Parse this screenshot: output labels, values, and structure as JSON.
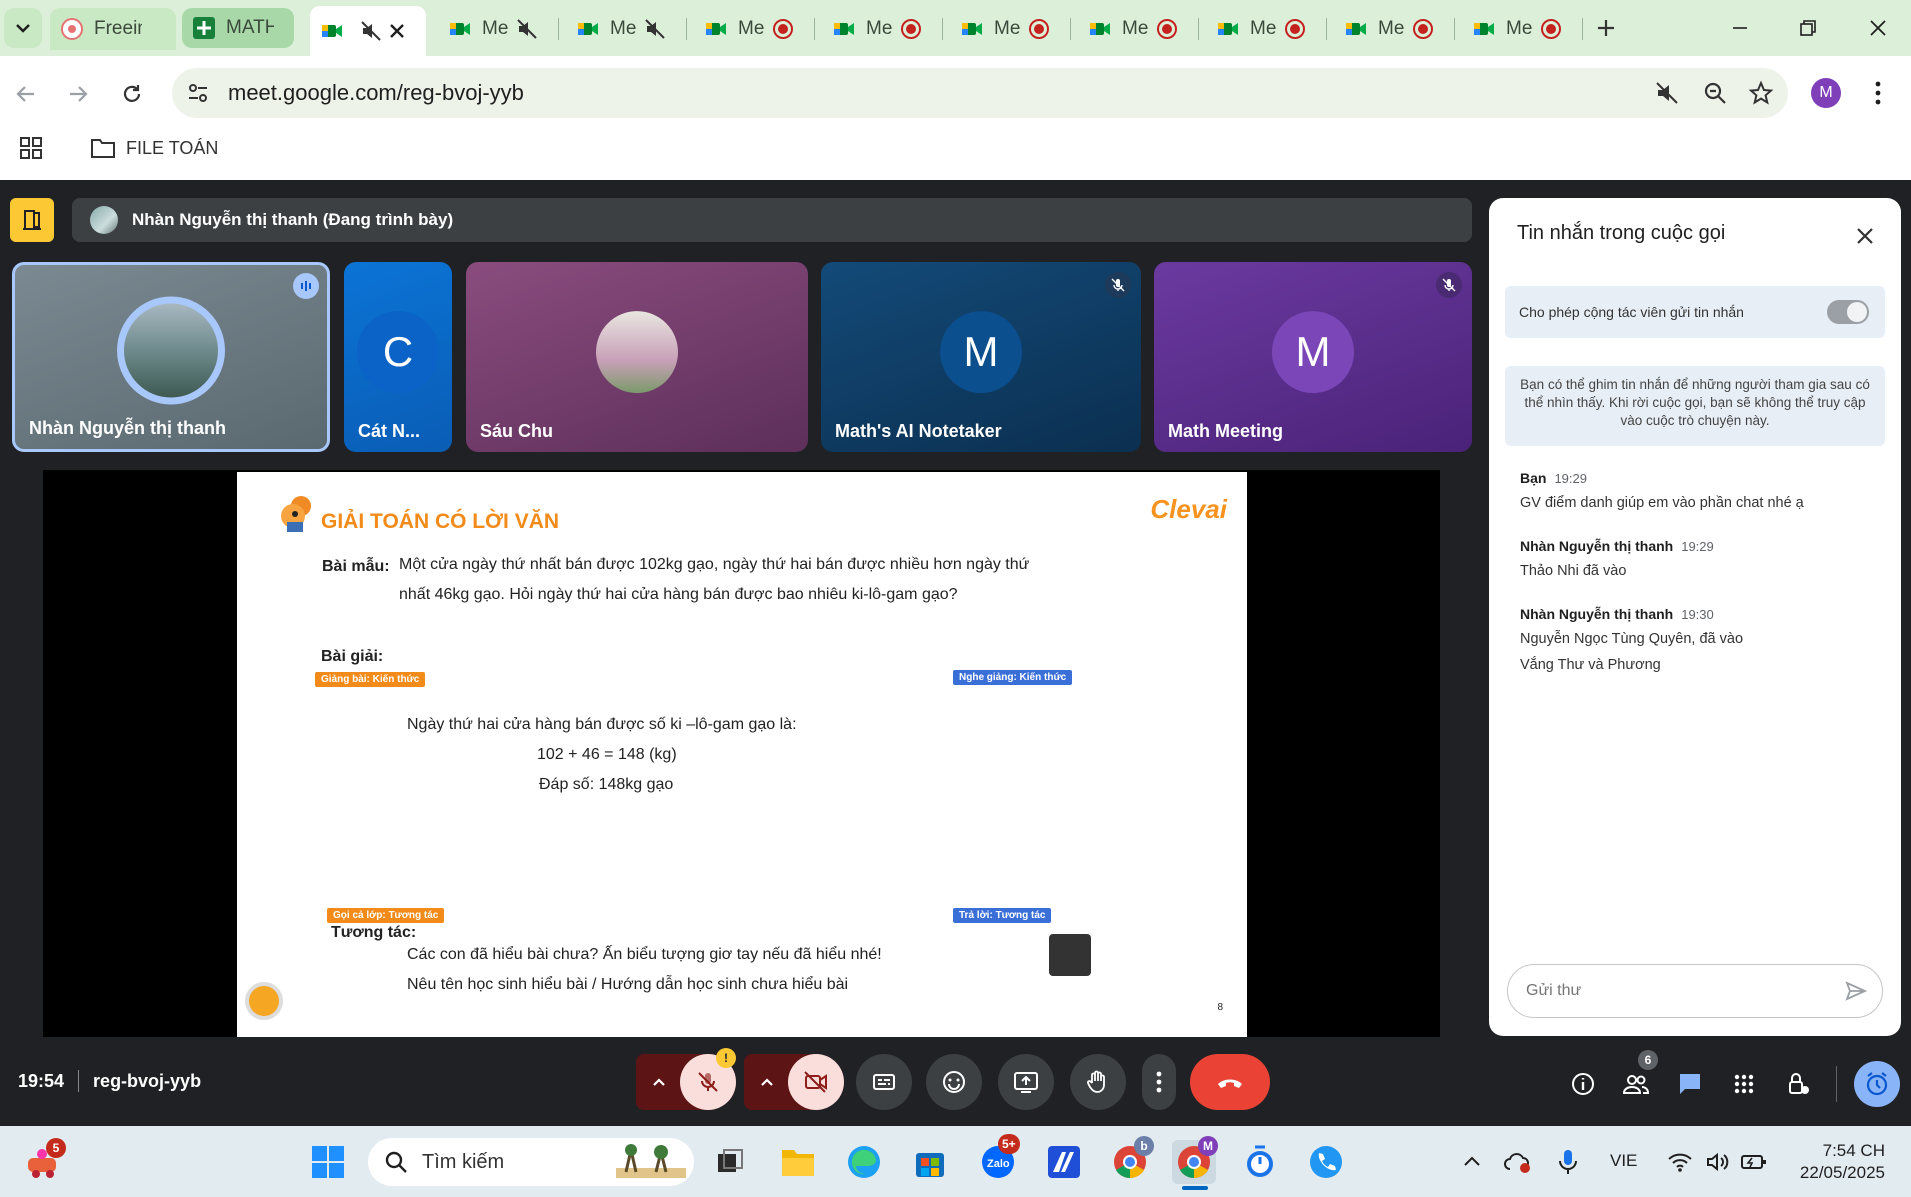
{
  "browser": {
    "tabs": [
      {
        "label": "Freeima",
        "kind": "freeimage"
      },
      {
        "label": "MATH_",
        "kind": "sheets"
      },
      {
        "label": "",
        "kind": "meet-active"
      },
      {
        "label": "Me",
        "kind": "meet-muted"
      },
      {
        "label": "Me",
        "kind": "meet-muted"
      },
      {
        "label": "Me",
        "kind": "meet-rec"
      },
      {
        "label": "Me",
        "kind": "meet-rec"
      },
      {
        "label": "Me",
        "kind": "meet-rec"
      },
      {
        "label": "Me",
        "kind": "meet-rec"
      },
      {
        "label": "Me",
        "kind": "meet-rec"
      },
      {
        "label": "Me",
        "kind": "meet-rec"
      },
      {
        "label": "Me",
        "kind": "meet-rec"
      }
    ],
    "url": "meet.google.com/reg-bvoj-yyb",
    "profile_initial": "M",
    "bookmark_folder": "FILE TOÁN"
  },
  "meet": {
    "presenting_text": "Nhàn Nguyễn thị thanh (Đang trình bày)",
    "tiles": [
      {
        "name": "Nhàn Nguyễn thị thanh",
        "initial": "",
        "bg": "#6f7d86"
      },
      {
        "name": "Cát N...",
        "initial": "C",
        "bg": "#1a73e8"
      },
      {
        "name": "Sáu Chu",
        "initial": "",
        "bg": "#7b3f6e"
      },
      {
        "name": "Math's AI Notetaker",
        "initial": "M",
        "bg": "#0d3c61"
      },
      {
        "name": "Math Meeting",
        "initial": "M",
        "bg": "#5b2d8c"
      }
    ],
    "slide": {
      "title": "GIẢI TOÁN CÓ LỜI VĂN",
      "brand": "Clevai",
      "sample_label": "Bài mẫu:",
      "sample_line1": "Một cửa ngày thứ nhất bán được 102kg gạo, ngày thứ hai bán được nhiều hơn ngày thứ",
      "sample_line2": "nhất 46kg gạo. Hỏi ngày thứ hai cửa hàng bán được bao nhiêu ki-lô-gam gạo?",
      "solution_label": "Bài giải:",
      "tag1": "Giảng bài: Kiến thức",
      "tag2": "Nghe giảng: Kiến thức",
      "answer1": "Ngày thứ hai cửa hàng bán được số ki –lô-gam gạo là:",
      "answer2": "102 + 46 = 148 (kg)",
      "answer3": "Đáp số: 148kg gạo",
      "tag3": "Gọi cả lớp: Tương tác",
      "tag4": "Trả lời: Tương tác",
      "interact_label": "Tương tác:",
      "interact1": "Các con đã hiểu bài chưa? Ấn biểu tượng giơ tay nếu đã hiểu nhé!",
      "interact2": "Nêu tên học sinh hiểu bài / Hướng dẫn học sinh chưa hiểu bài",
      "page_number": "8"
    },
    "chat": {
      "title": "Tin nhắn trong cuộc gọi",
      "toggle_label": "Cho phép cộng tác viên gửi tin nhắn",
      "info": "Bạn có thể ghim tin nhắn để những người tham gia sau có thể nhìn thấy. Khi rời cuộc gọi, bạn sẽ không thể truy cập vào cuộc trò chuyện này.",
      "messages": [
        {
          "who": "Bạn",
          "time": "19:29",
          "lines": [
            "GV điểm danh giúp em vào phần chat nhé ạ"
          ]
        },
        {
          "who": "Nhàn Nguyễn thị thanh",
          "time": "19:29",
          "lines": [
            "Thảo Nhi đã vào"
          ]
        },
        {
          "who": "Nhàn Nguyễn thị thanh",
          "time": "19:30",
          "lines": [
            "Nguyễn Ngọc Tùng Quyên, đã vào",
            "Vắng Thư và Phương"
          ]
        }
      ],
      "input_placeholder": "Gửi thư"
    },
    "bottom": {
      "time": "19:54",
      "meeting_code": "reg-bvoj-yyb",
      "participant_count": "6",
      "mic_warning": "!"
    }
  },
  "taskbar": {
    "search_placeholder": "Tìm kiếm",
    "lang": "VIE",
    "time": "7:54 CH",
    "date": "22/05/2025",
    "badge_app": "5",
    "badge_zalo": "5+",
    "badge_chrome_b": "b",
    "badge_chrome_m": "M"
  },
  "colors": {
    "meet_bg": "#202124",
    "end_call": "#ea4335",
    "accent": "#1a73e8",
    "slide_orange": "#f28b1a"
  }
}
